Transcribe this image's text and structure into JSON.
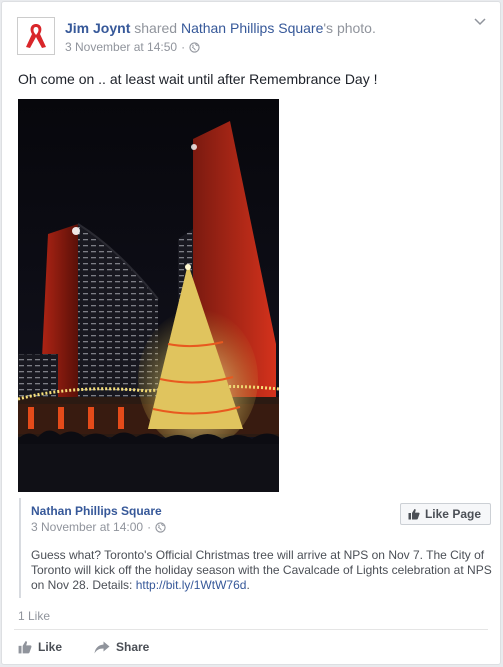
{
  "post": {
    "author": "Jim Joynt",
    "action_text": " shared ",
    "page_ref": "Nathan Phillips Square",
    "suffix": "'s photo.",
    "timestamp": "3 November at 14:50",
    "text": "Oh come on .. at least wait until after Remembrance Day !",
    "likes_count": "1 Like"
  },
  "shared": {
    "page_name": "Nathan Phillips Square",
    "timestamp": "3 November at 14:00",
    "like_page_label": "Like Page",
    "description_main": "Guess what? Toronto's Official Christmas tree will arrive at NPS on Nov 7. The City of Toronto will kick off the holiday season with the Cavalcade of Lights celebration at NPS on Nov 28. Details: ",
    "description_link": "http://bit.ly/1WtW76d",
    "description_end": "."
  },
  "actions": {
    "like_label": "Like",
    "share_label": "Share"
  },
  "icons": {
    "avatar": "red-ribbon-icon",
    "privacy": "globe-icon",
    "menu": "chevron-down-icon",
    "like": "thumbs-up-icon",
    "share": "share-arrow-icon"
  },
  "colors": {
    "link": "#365899",
    "muted": "#90949c",
    "ribbon": "#d9262a"
  }
}
